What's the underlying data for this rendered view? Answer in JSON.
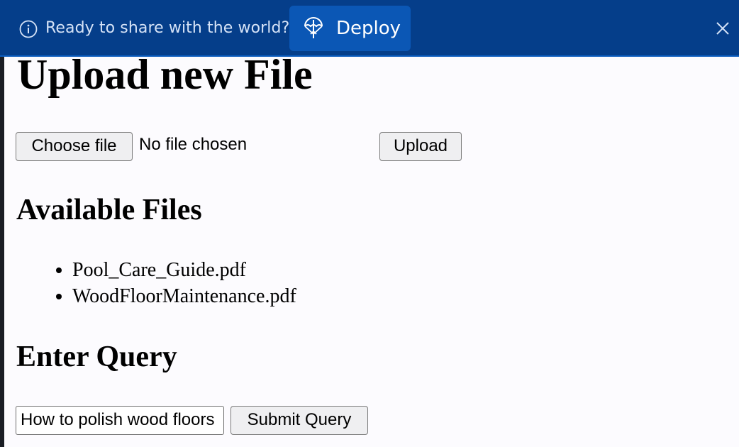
{
  "banner": {
    "message": "Ready to share with the world?",
    "deploy_label": "Deploy",
    "background": "#053e8a",
    "button_color": "#0b57b5",
    "icons": [
      "info-icon",
      "deploy-icon",
      "close-icon"
    ]
  },
  "upload": {
    "title": "Upload new File",
    "choose_label": "Choose file",
    "file_status": "No file chosen",
    "upload_label": "Upload"
  },
  "files": {
    "heading": "Available Files",
    "items": [
      "Pool_Care_Guide.pdf",
      "WoodFloorMaintenance.pdf"
    ]
  },
  "query": {
    "heading": "Enter Query",
    "input_value": "How to polish wood floors",
    "submit_label": "Submit Query"
  }
}
